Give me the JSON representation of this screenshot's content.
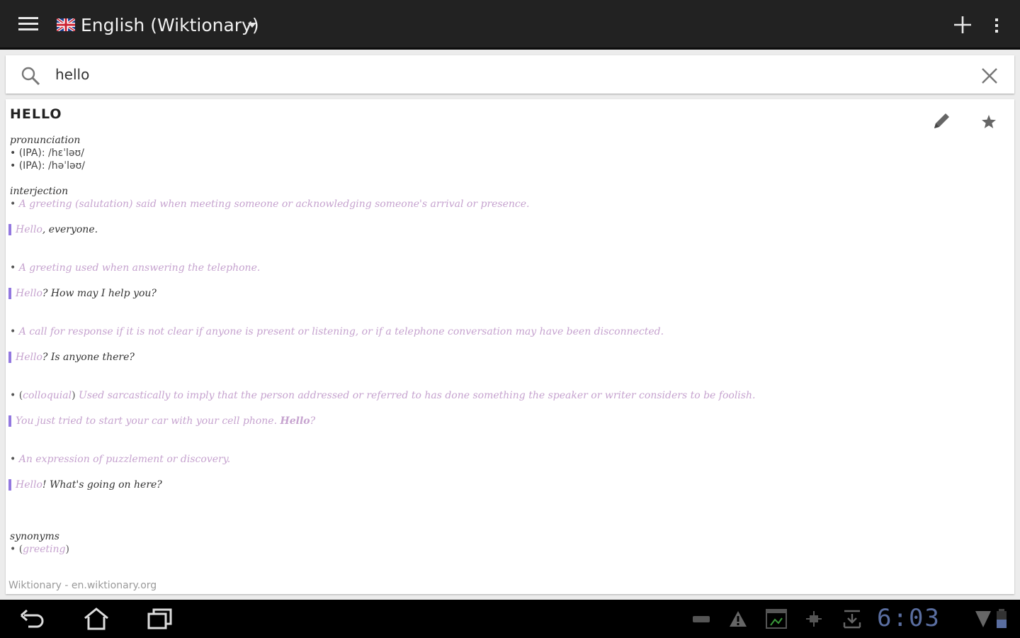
{
  "actionbar": {
    "title": "English (Wiktionary)"
  },
  "search": {
    "value": "hello"
  },
  "entry": {
    "headword": "HELLO",
    "pron_label": "pronunciation",
    "pron1": "• (IPA): /hɛˈləʊ/",
    "pron2": "• (IPA): /həˈləʊ/",
    "pos_label": "interjection",
    "d1_bullet": "•",
    "d1_text": "A greeting (salutation) said when meeting someone or acknowledging someone's arrival or presence.",
    "e1_hl": "Hello",
    "e1_rest": ", everyone.",
    "d2_bullet": "•",
    "d2_text": "A greeting used when answering the telephone.",
    "e2_hl": "Hello",
    "e2_rest": "? How may I help you?",
    "d3_bullet": "•",
    "d3_text": "A call for response if it is not clear if anyone is present or listening, or if a telephone conversation may have been disconnected.",
    "e3_hl": "Hello",
    "e3_rest": "? Is anyone there?",
    "d4_bullet": "• (",
    "d4_tag": "colloquial",
    "d4_close": ")",
    "d4_text": " Used sarcastically to imply that the person addressed or referred to has done something the speaker or writer considers to be foolish.",
    "e4_text": "You just tried to start your car with your cell phone. ",
    "e4_strong": "Hello",
    "e4_end": "?",
    "d5_bullet": "•",
    "d5_text": "An expression of puzzlement or discovery.",
    "e5_hl": "Hello",
    "e5_rest": "! What's going on here?",
    "syn_label": "synonyms",
    "syn_open": "• (",
    "syn_link": "greeting",
    "syn_close": ")",
    "source": "Wiktionary - en.wiktionary.org"
  },
  "statusbar": {
    "time": "6:03"
  },
  "colors": {
    "accent": "#9378e0",
    "link": "#c6a3cf",
    "clock": "#5a6ea0",
    "actionbar": "#222222"
  }
}
